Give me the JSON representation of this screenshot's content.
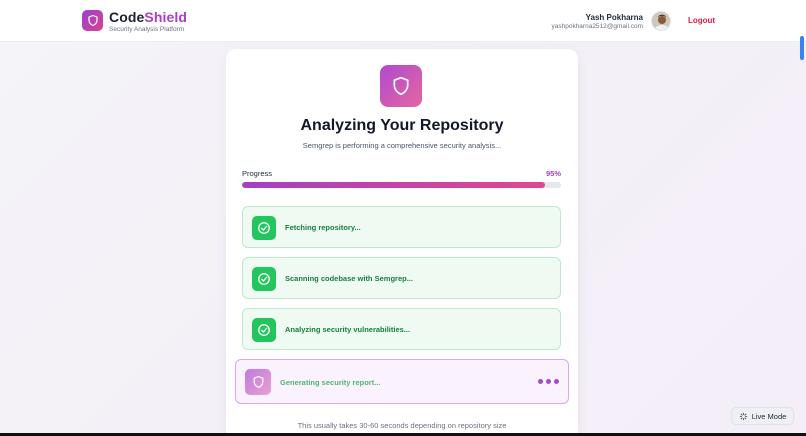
{
  "header": {
    "brand": "CodeShield",
    "tagline": "Security Analysis Platform",
    "user_name": "Yash Pokharna",
    "user_email": "yashpokharna2512@gmail.com",
    "logout_label": "Logout"
  },
  "analysis": {
    "title": "Analyzing Your Repository",
    "subtitle": "Semgrep is performing a comprehensive security analysis...",
    "progress_label": "Progress",
    "progress_text": "95%",
    "progress_value": 0.95,
    "steps": [
      {
        "label": "Fetching repository...",
        "status": "done",
        "icon": "check-circle-icon"
      },
      {
        "label": "Scanning codebase with Semgrep...",
        "status": "done",
        "icon": "check-circle-icon"
      },
      {
        "label": "Analyzing security vulnerabilities...",
        "status": "done",
        "icon": "check-circle-icon"
      },
      {
        "label": "Generating security report...",
        "status": "active",
        "icon": "shield-icon"
      }
    ],
    "footer_note": "This usually takes 30-60 seconds depending on repository size"
  },
  "live_mode": {
    "label": "Live Mode",
    "icon": "sparkle-icon"
  },
  "colors": {
    "brand_gradient_start": "#9b3fd4",
    "brand_gradient_end": "#d9438f",
    "success": "#22c55e",
    "logout": "#e11d48"
  }
}
